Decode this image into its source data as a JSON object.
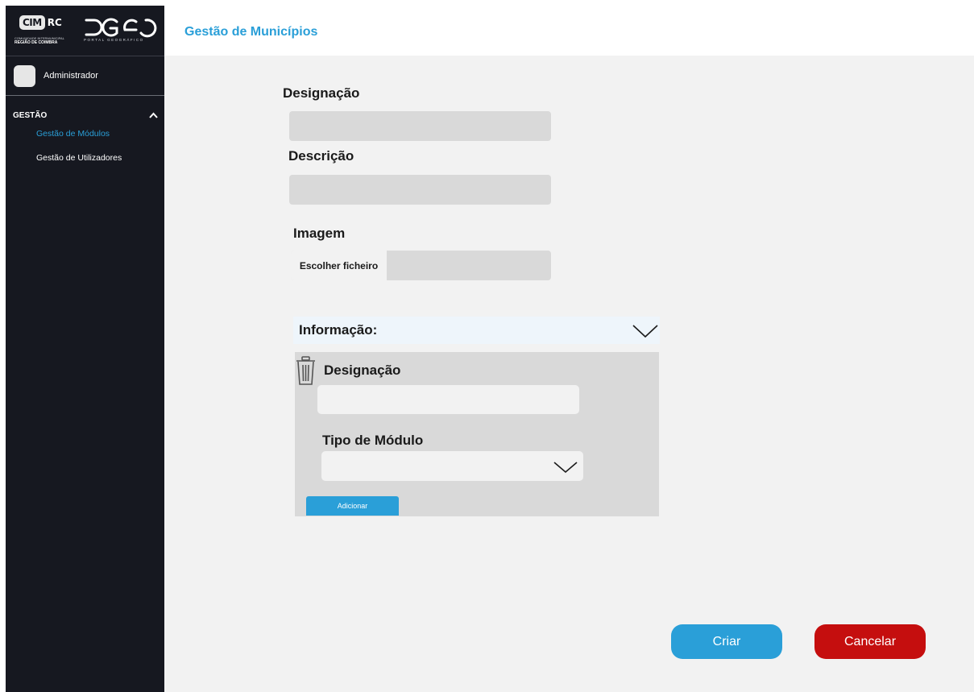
{
  "brand": {
    "cim_badge": "CIM",
    "cim_suffix": "RC",
    "cim_subtitle": "COMUNIDADE INTERMUNICIPAL",
    "cim_region": "REGIÃO DE COIMBRA",
    "pgeo_subtitle": "PORTAL GEOGRÁFICO"
  },
  "user": {
    "name": "Administrador"
  },
  "sidebar": {
    "section_label": "GESTÃO",
    "items": [
      {
        "label": "Gestão de Módulos",
        "active": true
      },
      {
        "label": "Gestão de Utilizadores",
        "active": false
      }
    ]
  },
  "header": {
    "title": "Gestão de Municípios"
  },
  "form": {
    "designacao_label": "Designação",
    "designacao_value": "",
    "descricao_label": "Descrição",
    "descricao_value": "",
    "imagem_label": "Imagem",
    "file_button_label": "Escolher ficheiro",
    "info_section": {
      "title": "Informação:",
      "designacao_label": "Designação",
      "designacao_value": "",
      "tipo_modulo_label": "Tipo de Módulo",
      "tipo_modulo_value": "",
      "add_button": "Adicionar"
    }
  },
  "actions": {
    "create": "Criar",
    "cancel": "Cancelar"
  },
  "colors": {
    "accent": "#2a9fd8",
    "danger": "#c50e0e",
    "sidebar": "#161820",
    "content_bg": "#f2f2f2",
    "field": "#d9d9d9"
  },
  "icons": [
    "chevron-up-icon",
    "chevron-down-icon",
    "trash-icon"
  ]
}
